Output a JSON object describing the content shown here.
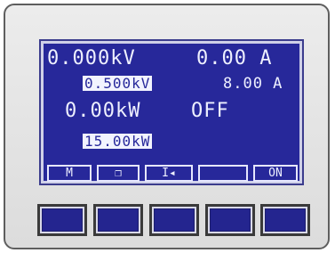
{
  "display": {
    "voltage_actual": "0.000kV",
    "current_actual": "0.00 A",
    "voltage_set": "0.500kV",
    "current_set": "8.00 A",
    "power_actual": "0.00kW",
    "output_state": "OFF",
    "power_set": "15.00kW"
  },
  "softkeys": [
    "M",
    "❐",
    "I◂",
    "",
    "ON"
  ],
  "colors": {
    "lcd_background": "#27289a",
    "lcd_text": "#eef0ff",
    "button": "#24258f"
  }
}
